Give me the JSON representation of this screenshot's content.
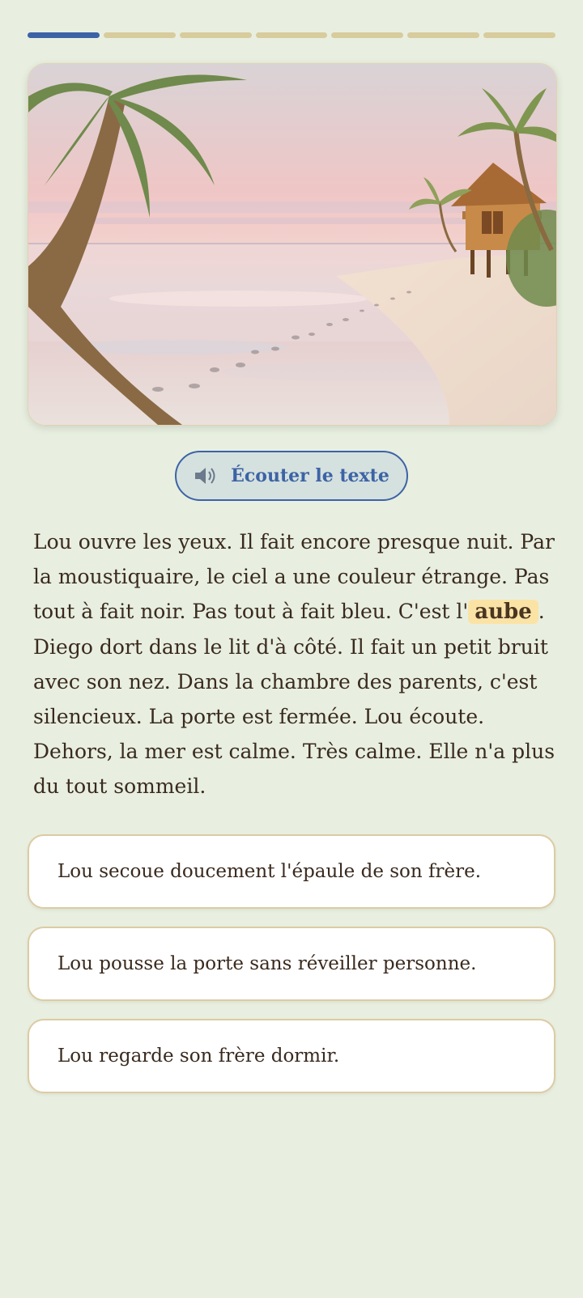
{
  "progress": {
    "total_steps": 7,
    "current_step": 1,
    "colors": {
      "active": "#3c63a6",
      "inactive": "#d8cb9d"
    }
  },
  "illustration": {
    "alt_subject": "beach-at-dawn-with-palm-trees-and-stilt-hut-icon"
  },
  "listen_button": {
    "icon": "speaker-icon",
    "label": "Écouter le texte"
  },
  "story": {
    "part1": "Lou ouvre les yeux. Il fait encore presque nuit. Par la moustiquaire, le ciel a une couleur étrange. Pas tout à fait noir. Pas tout à fait bleu. C'est l'",
    "vocab_word": "aube",
    "part2": ". Diego dort dans le lit d'à côté. Il fait un petit bruit avec son nez. Dans la chambre des parents, c'est silencieux. La porte est fermée. Lou écoute. Dehors, la mer est calme. Très calme. Elle n'a plus du tout sommeil."
  },
  "choices": [
    {
      "label": "Lou secoue doucement l'épaule de son frère."
    },
    {
      "label": "Lou pousse la porte sans réveiller personne."
    },
    {
      "label": "Lou regarde son frère dormir."
    }
  ],
  "colors": {
    "background": "#e8efe0",
    "accent": "#3c63a6",
    "highlight": "#fbe3a6",
    "card_border": "#ddcba3"
  }
}
